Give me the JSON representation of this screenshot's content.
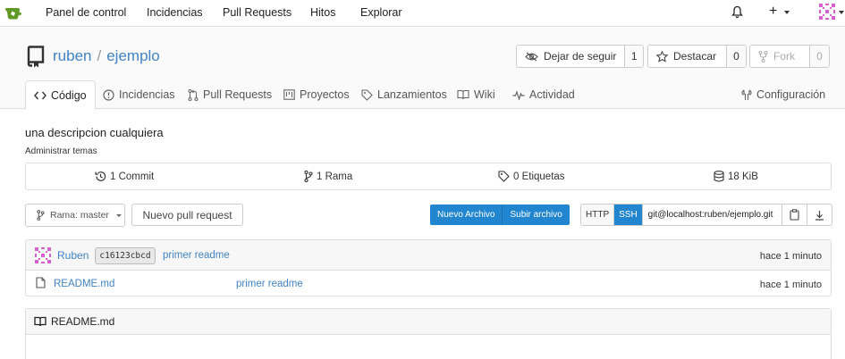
{
  "nav": {
    "items": [
      "Panel de control",
      "Incidencias",
      "Pull Requests",
      "Hitos",
      "Explorar"
    ],
    "plus": "+"
  },
  "repo": {
    "owner": "ruben",
    "separator": "/",
    "name": "ejemplo",
    "watch": {
      "label": "Dejar de seguir",
      "count": "1"
    },
    "star": {
      "label": "Destacar",
      "count": "0"
    },
    "fork": {
      "label": "Fork",
      "count": "0"
    }
  },
  "tabs": [
    {
      "label": "Código",
      "icon": "code-icon"
    },
    {
      "label": "Incidencias",
      "icon": "issue-icon"
    },
    {
      "label": "Pull Requests",
      "icon": "pull-request-icon"
    },
    {
      "label": "Proyectos",
      "icon": "project-icon"
    },
    {
      "label": "Lanzamientos",
      "icon": "tag-icon"
    },
    {
      "label": "Wiki",
      "icon": "book-icon"
    },
    {
      "label": "Actividad",
      "icon": "pulse-icon"
    },
    {
      "label": "Configuración",
      "icon": "tools-icon"
    }
  ],
  "description": "una descripcion cualquiera",
  "manage_topics": "Administrar temas",
  "stats": {
    "commits": "1 Commit",
    "branches": "1 Rama",
    "tags": "0 Etiquetas",
    "size": "18 KiB"
  },
  "toolbar": {
    "branch": "Rama: master",
    "new_pr": "Nuevo pull request",
    "new_file": "Nuevo Archivo",
    "upload_file": "Subir archivo",
    "http": "HTTP",
    "ssh": "SSH",
    "clone_url": "git@localhost:ruben/ejemplo.git"
  },
  "latest_commit": {
    "author": "Ruben",
    "sha": "c16123cbcd",
    "message": "primer readme",
    "time": "hace 1 minuto"
  },
  "files": [
    {
      "name": "README.md",
      "message": "primer readme",
      "time": "hace 1 minuto"
    }
  ],
  "readme": {
    "title": "README.md"
  },
  "colors": {
    "accent": "#2185d0",
    "link": "#4183c4",
    "logo": "#609926",
    "identicon": "#d85fd0"
  }
}
